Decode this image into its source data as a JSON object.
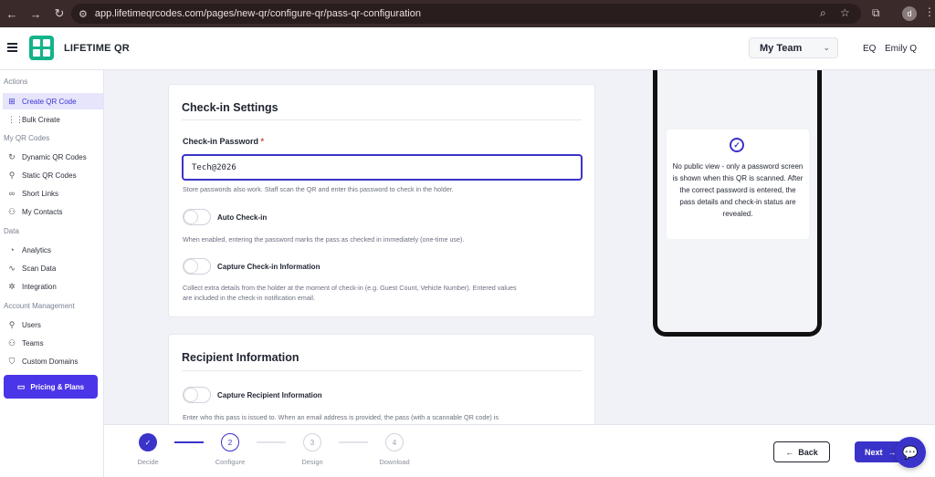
{
  "browser": {
    "url": "app.lifetimeqrcodes.com/pages/new-qr/configure-qr/pass-qr-configuration",
    "profile_initial": "d"
  },
  "header": {
    "brand": "LIFETIME QR",
    "team_select": "My Team",
    "user_initials": "EQ",
    "user_name": "Emily Q"
  },
  "sidebar": {
    "sections": {
      "actions": "Actions",
      "my_qr_codes": "My QR Codes",
      "data": "Data",
      "account": "Account Management"
    },
    "items": [
      {
        "label": "Create QR Code",
        "icon": "plus-square-icon"
      },
      {
        "label": "Bulk Create",
        "icon": "grid-icon"
      },
      {
        "label": "Dynamic QR Codes",
        "icon": "refresh-icon"
      },
      {
        "label": "Static QR Codes",
        "icon": "pin-icon"
      },
      {
        "label": "Short Links",
        "icon": "link-icon"
      },
      {
        "label": "My Contacts",
        "icon": "contacts-icon"
      },
      {
        "label": "Analytics",
        "icon": "pie-chart-icon"
      },
      {
        "label": "Scan Data",
        "icon": "activity-icon"
      },
      {
        "label": "Integration",
        "icon": "plug-icon"
      },
      {
        "label": "Users",
        "icon": "user-plus-icon"
      },
      {
        "label": "Teams",
        "icon": "users-icon"
      },
      {
        "label": "Custom Domains",
        "icon": "shield-icon"
      }
    ],
    "pricing_label": "Pricing & Plans"
  },
  "checkin": {
    "title": "Check-in Settings",
    "password_label": "Check-in Password",
    "required_mark": "*",
    "password_value": "Tech@2026",
    "password_help": "Store passwords also work. Staff scan the QR and enter this password to check in the holder.",
    "auto_label": "Auto Check-in",
    "auto_help": "When enabled, entering the password marks the pass as checked in immediately (one-time use).",
    "capture_label": "Capture Check-in Information",
    "capture_help_1": "Collect extra details from the holder at the moment of check-in (e.g. Guest Count, Vehicle Number). Entered values",
    "capture_help_2": "are included in the check-in notification email."
  },
  "recipient": {
    "title": "Recipient Information",
    "capture_label": "Capture Recipient Information",
    "help": "Enter who this pass is issued to. When an email address is provided, the pass (with a scannable QR code) is"
  },
  "preview": {
    "text": "No public view - only a password screen is shown when this QR is scanned. After the correct password is entered, the pass details and check-in status are revealed."
  },
  "steps": [
    {
      "num": "✓",
      "label": "Decide",
      "state": "done"
    },
    {
      "num": "2",
      "label": "Configure",
      "state": "current"
    },
    {
      "num": "3",
      "label": "Design",
      "state": "todo"
    },
    {
      "num": "4",
      "label": "Download",
      "state": "todo"
    }
  ],
  "buttons": {
    "back": "Back",
    "next": "Next"
  },
  "colors": {
    "accent": "#3a33c9",
    "pricing": "#4b35e8",
    "logo": "#13b38a"
  }
}
